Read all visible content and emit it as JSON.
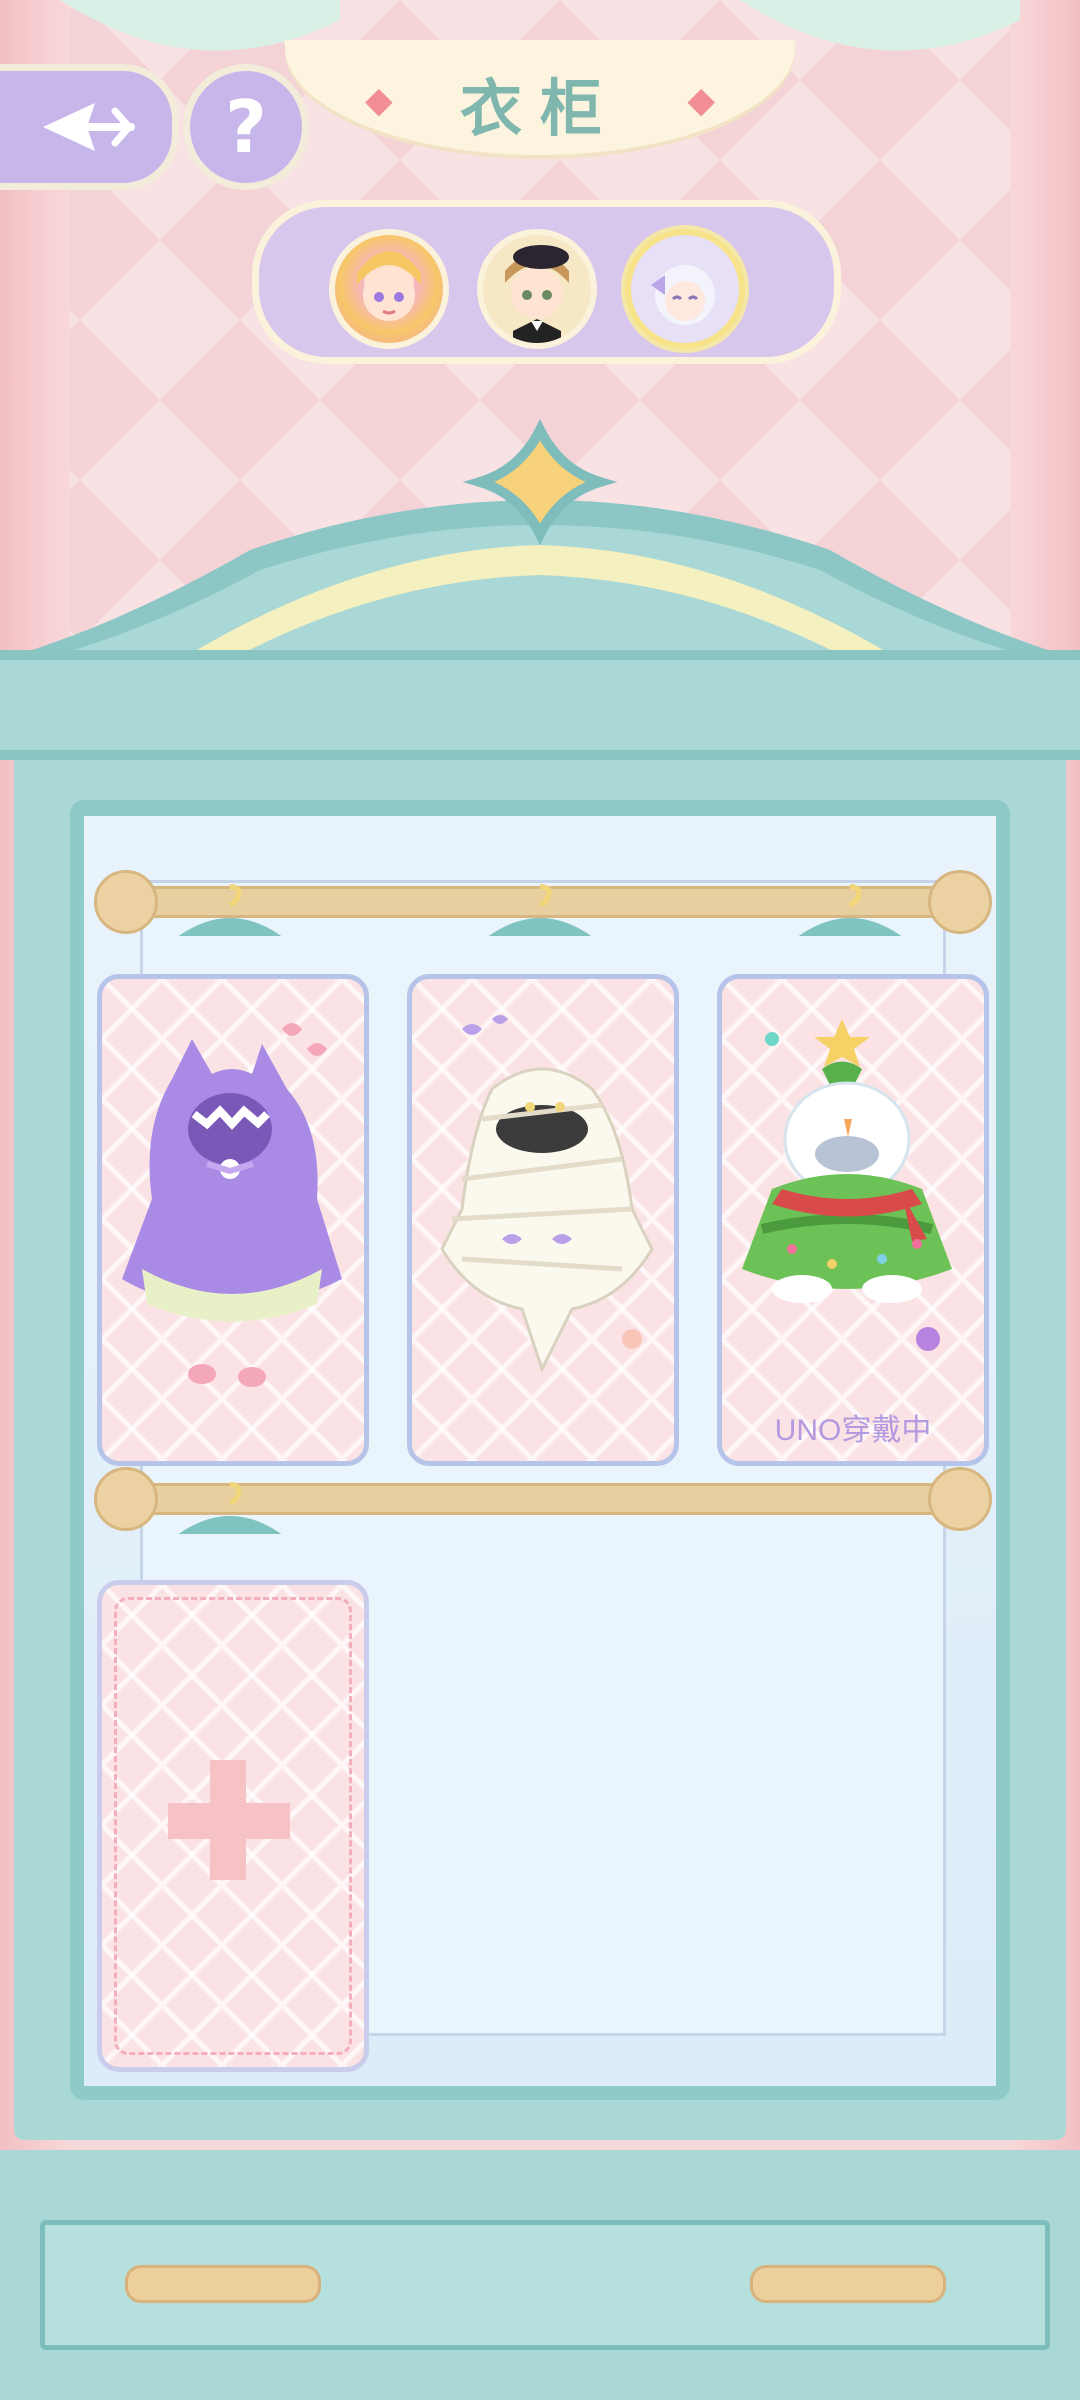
{
  "header": {
    "title": "衣柜",
    "back_icon": "back-arrow-icon",
    "help_label": "?"
  },
  "characters": [
    {
      "name": "blonde-girl-avatar",
      "selected": false
    },
    {
      "name": "brown-hair-avatar",
      "selected": false
    },
    {
      "name": "silver-hair-avatar",
      "selected": true
    }
  ],
  "wardrobe": {
    "outfits": [
      {
        "icon": "purple-monster-hoodie-icon",
        "status": ""
      },
      {
        "icon": "mummy-costume-icon",
        "status": ""
      },
      {
        "icon": "christmas-tree-snowman-costume-icon",
        "status": "UNO穿戴中"
      }
    ],
    "add_slot_icon": "plus-icon"
  },
  "colors": {
    "accent_mint": "#a9d8d6",
    "accent_purple": "#c7b6ea",
    "background_pink": "#f6d7d9"
  }
}
